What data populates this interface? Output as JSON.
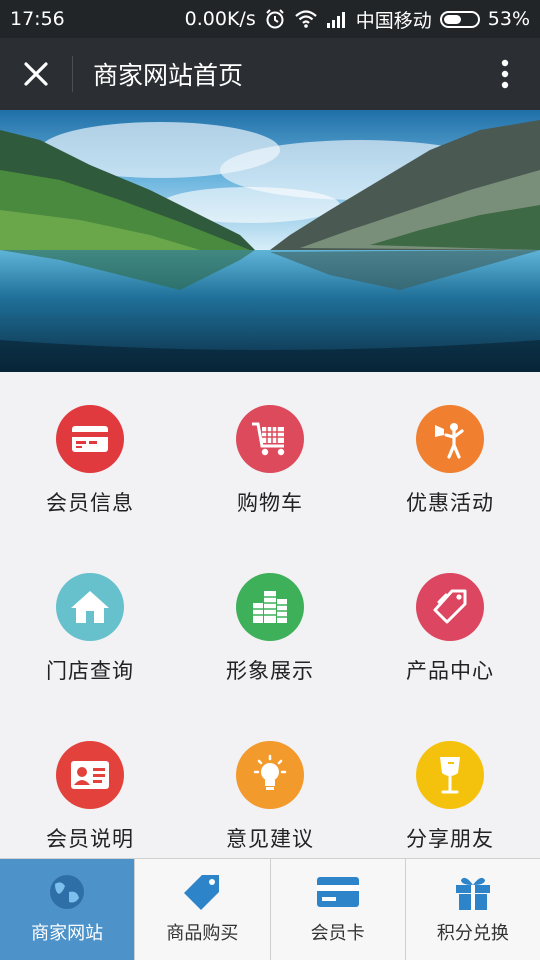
{
  "status": {
    "time": "17:56",
    "speed": "0.00K/s",
    "carrier": "中国移动",
    "battery": "53%",
    "battery_level": 0.53
  },
  "header": {
    "title": "商家网站首页",
    "close_icon": "close-icon",
    "more_icon": "more-vertical-icon"
  },
  "banner": {
    "image": "mountain-lake-landscape"
  },
  "menu": [
    {
      "label": "会员信息",
      "icon": "card-icon",
      "color": "#e0393e"
    },
    {
      "label": "购物车",
      "icon": "cart-icon",
      "color": "#dd4a5c"
    },
    {
      "label": "优惠活动",
      "icon": "megaphone-person-icon",
      "color": "#f07f30"
    },
    {
      "label": "门店查询",
      "icon": "house-icon",
      "color": "#67c1cc"
    },
    {
      "label": "形象展示",
      "icon": "building-icon",
      "color": "#3fb05a"
    },
    {
      "label": "产品中心",
      "icon": "tags-icon",
      "color": "#dc4660"
    },
    {
      "label": "会员说明",
      "icon": "id-card-icon",
      "color": "#e3423c"
    },
    {
      "label": "意见建议",
      "icon": "lightbulb-icon",
      "color": "#f29a2c"
    },
    {
      "label": "分享朋友",
      "icon": "glass-icon",
      "color": "#f4c20d"
    }
  ],
  "tabs": [
    {
      "label": "商家网站",
      "icon": "globe-icon",
      "active": true
    },
    {
      "label": "商品购买",
      "icon": "tag-icon",
      "active": false
    },
    {
      "label": "会员卡",
      "icon": "credit-card-icon",
      "active": false
    },
    {
      "label": "积分兑换",
      "icon": "gift-icon",
      "active": false
    }
  ]
}
